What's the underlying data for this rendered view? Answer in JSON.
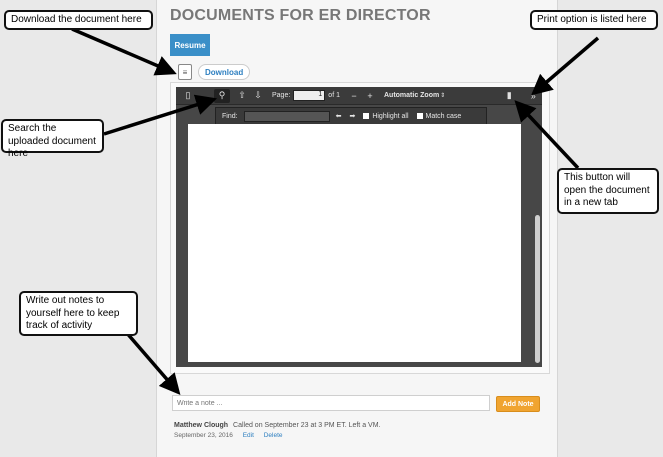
{
  "page": {
    "title": "DOCUMENTS FOR ER DIRECTOR",
    "tab_label": "Resume",
    "download_label": "Download"
  },
  "viewer": {
    "toolbar": {
      "page_label": "Page:",
      "page_value": "1",
      "page_of": "of 1",
      "minus": "−",
      "plus": "+",
      "zoom_label": "Automatic Zoom"
    },
    "find_bar": {
      "find_label": "Find:",
      "highlight_all": "Highlight all",
      "match_case": "Match case"
    }
  },
  "notes": {
    "placeholder": "Write a note ...",
    "add_label": "Add Note",
    "entries": [
      {
        "author": "Matthew Clough",
        "text": "Called on September 23 at 3 PM ET. Left a VM.",
        "date": "September 23, 2016",
        "edit_label": "Edit",
        "delete_label": "Delete"
      }
    ]
  },
  "callouts": {
    "download": "Download the document here",
    "print": "Print option is listed here",
    "search": "Search the uploaded document here",
    "new_tab": "This button will open the document in a new tab",
    "notes": "Write out notes to yourself here to keep track of activity"
  },
  "icons": {
    "sidebar_toggle": "sidebar-toggle-icon",
    "search": "search-icon",
    "page_up": "arrow-up-icon",
    "page_down": "arrow-down-icon",
    "bookmark": "bookmark-icon",
    "more_tools": "double-chevron-right-icon",
    "find_prev": "arrow-left-icon",
    "find_next": "arrow-right-icon",
    "document": "document-icon"
  }
}
